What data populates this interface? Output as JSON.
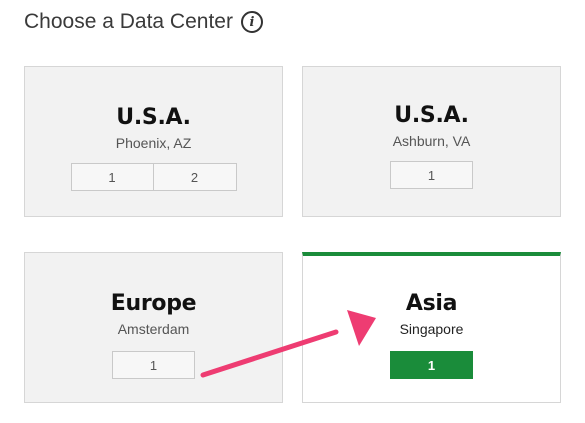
{
  "header": {
    "title": "Choose a Data Center",
    "info_icon": "info-icon"
  },
  "data_centers": [
    {
      "region": "U.S.A.",
      "city": "Phoenix, AZ",
      "buttons": [
        "1",
        "2"
      ],
      "selected": false
    },
    {
      "region": "U.S.A.",
      "city": "Ashburn, VA",
      "buttons": [
        "1"
      ],
      "selected": false
    },
    {
      "region": "Europe",
      "city": "Amsterdam",
      "buttons": [
        "1"
      ],
      "selected": false
    },
    {
      "region": "Asia",
      "city": "Singapore",
      "buttons": [
        "1"
      ],
      "selected": true
    }
  ],
  "colors": {
    "accent_green": "#1a8c3a",
    "arrow_pink": "#ee3c72",
    "card_background": "#f2f2f2"
  },
  "annotation": {
    "arrow_icon": "arrow-pointer-icon"
  }
}
